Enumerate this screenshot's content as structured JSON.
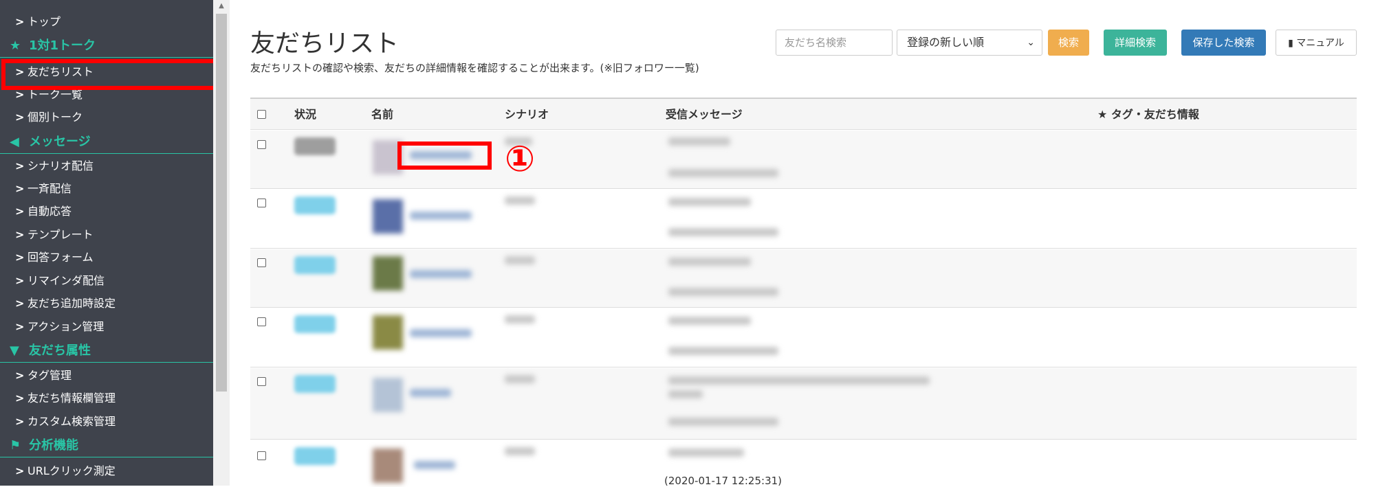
{
  "sidebar": {
    "items": [
      {
        "type": "item",
        "label": "トップ"
      },
      {
        "type": "head",
        "icon": "star-icon",
        "label": "1対1トーク"
      },
      {
        "type": "item",
        "label": "友だちリスト",
        "selected": true
      },
      {
        "type": "item",
        "label": "トーク一覧"
      },
      {
        "type": "item",
        "label": "個別トーク"
      },
      {
        "type": "head",
        "icon": "megaphone-icon",
        "label": "メッセージ"
      },
      {
        "type": "item",
        "label": "シナリオ配信"
      },
      {
        "type": "item",
        "label": "一斉配信"
      },
      {
        "type": "item",
        "label": "自動応答"
      },
      {
        "type": "item",
        "label": "テンプレート"
      },
      {
        "type": "item",
        "label": "回答フォーム"
      },
      {
        "type": "item",
        "label": "リマインダ配信"
      },
      {
        "type": "item",
        "label": "友だち追加時設定"
      },
      {
        "type": "item",
        "label": "アクション管理"
      },
      {
        "type": "head",
        "icon": "filter-icon",
        "label": "友だち属性"
      },
      {
        "type": "item",
        "label": "タグ管理"
      },
      {
        "type": "item",
        "label": "友だち情報欄管理"
      },
      {
        "type": "item",
        "label": "カスタム検索管理"
      },
      {
        "type": "head",
        "icon": "flag-icon",
        "label": "分析機能"
      },
      {
        "type": "item",
        "label": "URLクリック測定"
      }
    ]
  },
  "header": {
    "title": "友だちリスト",
    "description": "友だちリストの確認や検索、友だちの詳細情報を確認することが出来ます。(※旧フォロワー一覧)",
    "search_placeholder": "友だち名検索",
    "sort_value": "登録の新しい順",
    "search_button": "検索",
    "detail_search_button": "詳細検索",
    "saved_search_button": "保存した検索",
    "manual_button": "マニュアル"
  },
  "table": {
    "columns": [
      "状況",
      "名前",
      "シナリオ",
      "受信メッセージ",
      "★ タグ・友だち情報"
    ],
    "rows": [
      {
        "status_color": "#9e9e9e",
        "avatar": "#c9c3cf"
      },
      {
        "status_color": "#7fd0ea",
        "avatar": "#5a6fa8"
      },
      {
        "status_color": "#7fd0ea",
        "avatar": "#6b7a48"
      },
      {
        "status_color": "#7fd0ea",
        "avatar": "#8a8a45"
      },
      {
        "status_color": "#7fd0ea",
        "avatar": "#b4c3d6"
      },
      {
        "status_color": "#7fd0ea",
        "avatar": "#a88a7a",
        "timestamp": "(2020-01-17 12:25:31)"
      }
    ]
  },
  "annotation": {
    "number": "①",
    "color": "#ff0000"
  },
  "colors": {
    "sidebar_bg": "#3f434c",
    "accent": "#29c5a6",
    "highlight": "#ff0000"
  }
}
